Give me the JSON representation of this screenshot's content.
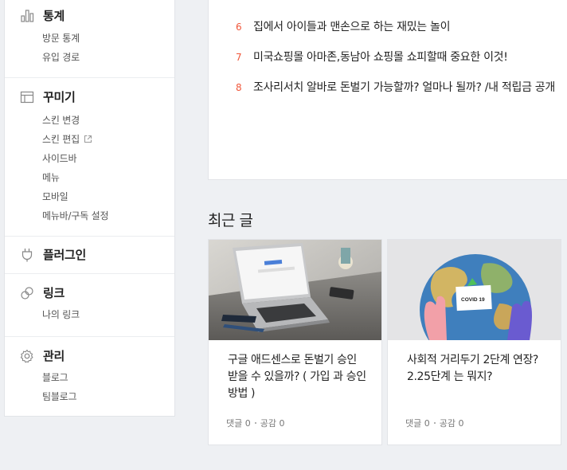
{
  "sidebar": {
    "stats": {
      "title": "통계",
      "items": [
        "방문 통계",
        "유입 경로"
      ]
    },
    "customize": {
      "title": "꾸미기",
      "items": [
        "스킨 변경",
        "스킨 편집",
        "사이드바",
        "메뉴",
        "모바일",
        "메뉴바/구독 설정"
      ]
    },
    "plugin": {
      "title": "플러그인"
    },
    "link": {
      "title": "링크",
      "items": [
        "나의 링크"
      ]
    },
    "manage": {
      "title": "관리",
      "items": [
        "블로그",
        "팀블로그"
      ]
    }
  },
  "popular": [
    {
      "rank": "6",
      "title": "집에서 아이들과 맨손으로 하는 재밌는 놀이"
    },
    {
      "rank": "7",
      "title": "미국쇼핑몰 아마존,동남아 쇼핑몰 쇼피할때 중요한 이것!"
    },
    {
      "rank": "8",
      "title": "조사리서치 알바로 돈벌기 가능할까? 얼마나 될까? /내 적립금 공개"
    }
  ],
  "recent": {
    "title": "최근 글",
    "posts": [
      {
        "title": "구글 애드센스로 돈벌기 승인 받을 수 있을까? ( 가입 과 승인 방법 )",
        "comments": "댓글 0",
        "likes": "공감 0",
        "image": "laptop-google-photo"
      },
      {
        "title": "사회적 거리두기 2단계 연장? 2.25단계 는 뭐지?",
        "comments": "댓글 0",
        "likes": "공감 0",
        "image": "globe-covid-photo",
        "image_label": "COVID 19"
      }
    ]
  },
  "colors": {
    "rank": "#f0563a",
    "background": "#eef0f3"
  }
}
